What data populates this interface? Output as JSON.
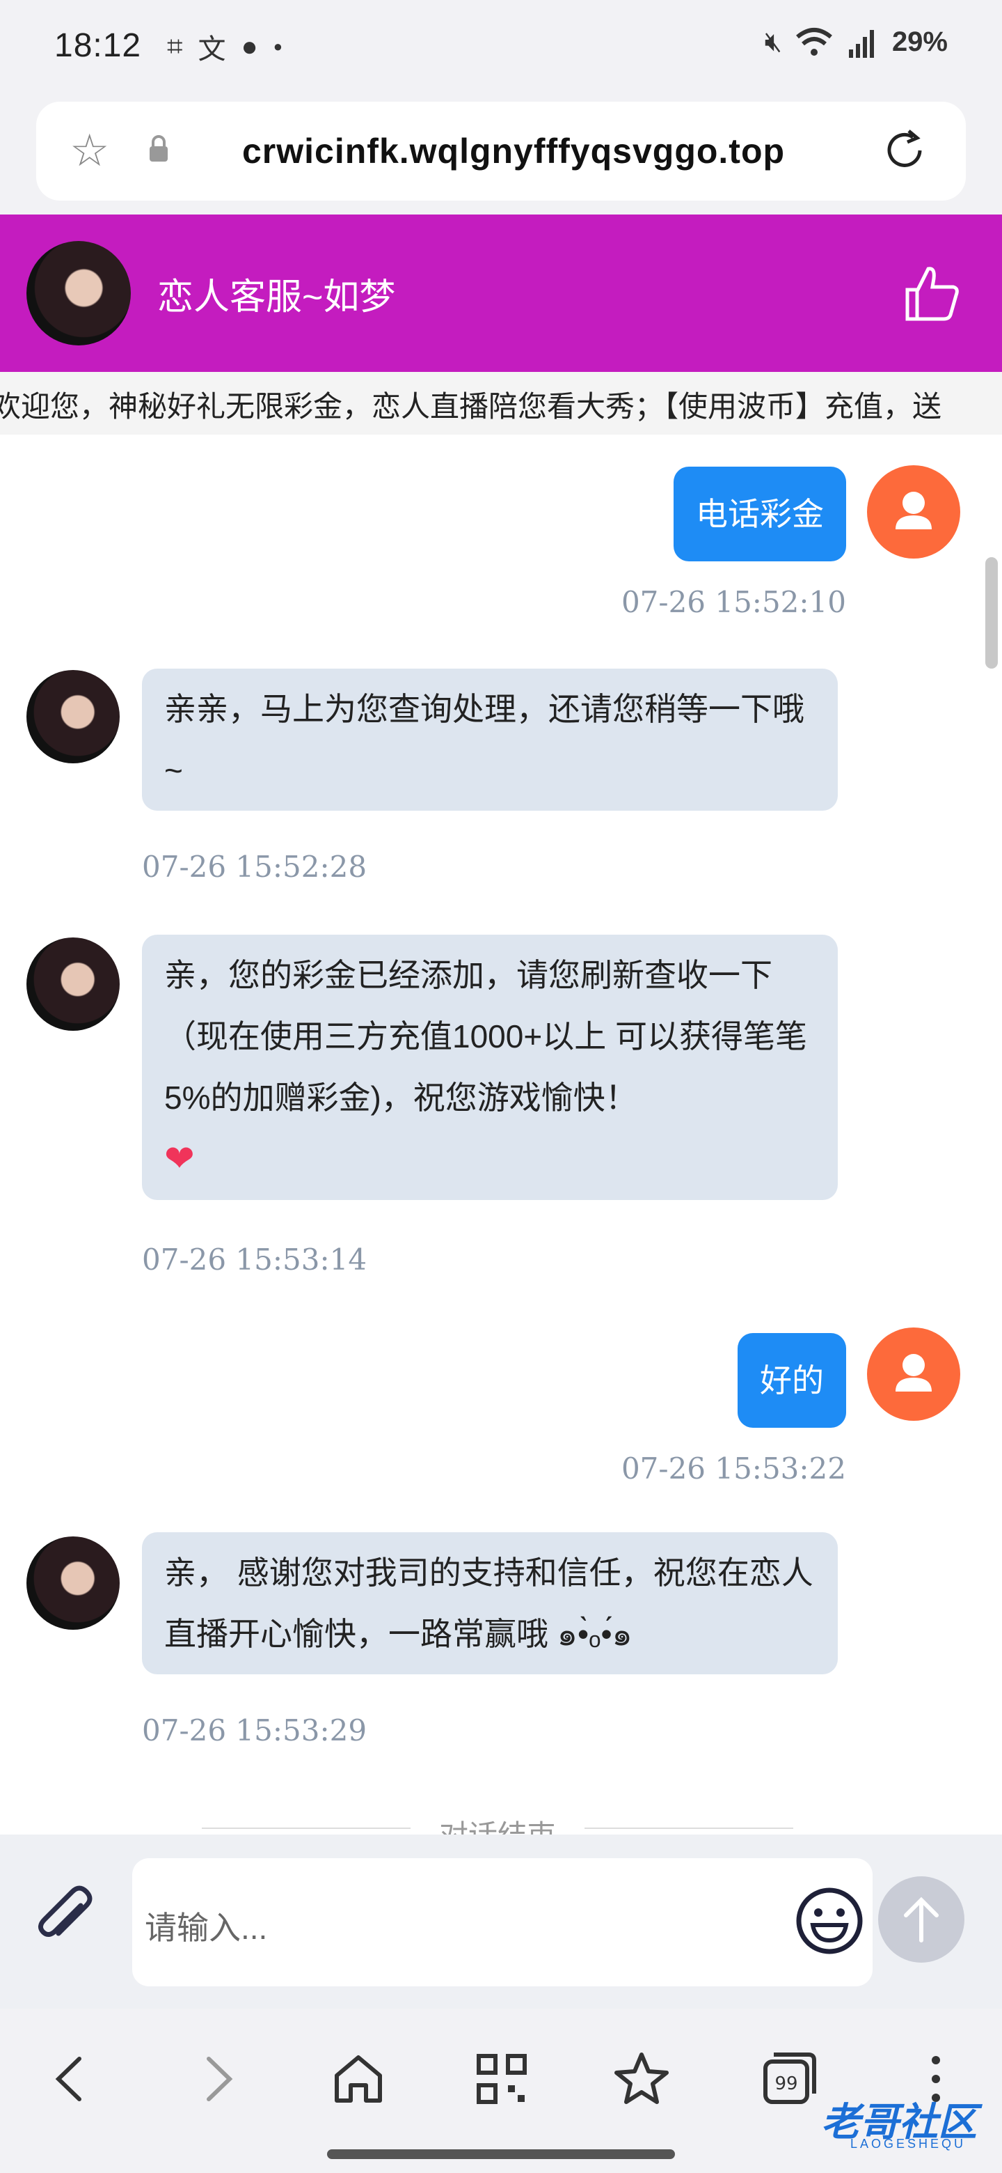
{
  "status_bar": {
    "time": "18:12",
    "battery": "29%",
    "left_icons": [
      "screenshot-icon",
      "translate-icon",
      "chat-notification-icon",
      "dot-icon"
    ],
    "right_icons": [
      "mute-icon",
      "wifi-icon",
      "signal-4g-icon"
    ]
  },
  "browser": {
    "url": "crwicinfk.wqlgnyfffyqsvggo.top"
  },
  "chat_header": {
    "title": "恋人客服~如梦",
    "accent_color": "#c41cbf"
  },
  "marquee": {
    "text": "欢迎您，神秘好礼无限彩金，恋人直播陪您看大秀；【使用波币】充值，送"
  },
  "messages": [
    {
      "sender": "user",
      "text": "电话彩金",
      "time": "07-26 15:52:10"
    },
    {
      "sender": "agent",
      "text": "亲亲，马上为您查询处理，还请您稍等一下哦~",
      "time": "07-26 15:52:28"
    },
    {
      "sender": "agent",
      "text": "亲，您的彩金已经添加，请您刷新查收一下（现在使用三方充值1000+以上 可以获得笔笔5%的加赠彩金)，祝您游戏愉快！",
      "emoji": "❤",
      "time": "07-26 15:53:14"
    },
    {
      "sender": "user",
      "text": "好的",
      "time": "07-26 15:53:22"
    },
    {
      "sender": "agent",
      "text": "亲， 感谢您对我司的支持和信任，祝您在恋人直播开心愉快，一路常赢哦 ๑•̀ₒ•́๑",
      "time": "07-26 15:53:29"
    }
  ],
  "chat_end": "对话结束",
  "input": {
    "placeholder": "请输入..."
  },
  "watermark": {
    "main": "老哥社区",
    "sub": "LAOGESHEQU"
  },
  "colors": {
    "user_bubble": "#1e8cf5",
    "agent_bubble": "#dde5ef",
    "user_avatar": "#fd6a3b"
  }
}
